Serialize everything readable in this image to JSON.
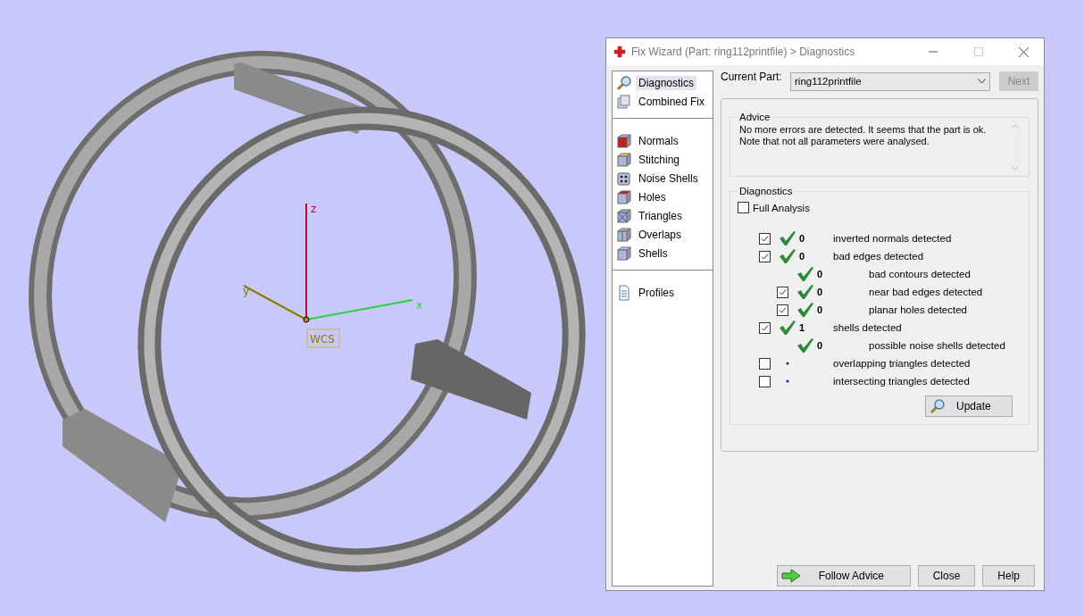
{
  "viewport": {
    "axes": [
      {
        "kind": "z",
        "label": "z"
      },
      {
        "kind": "y",
        "label": "y"
      },
      {
        "kind": "x",
        "label": "x"
      }
    ],
    "origin_label": "WCS"
  },
  "window": {
    "title": "Fix Wizard (Part: ring112printfile) > Diagnostics"
  },
  "sidebar": {
    "groups": [
      [
        {
          "label": "Diagnostics",
          "kind": "magnifier",
          "selected": true
        },
        {
          "label": "Combined Fix",
          "kind": "stack",
          "selected": false
        }
      ],
      [
        {
          "label": "Normals",
          "kind": "normals",
          "selected": false
        },
        {
          "label": "Stitching",
          "kind": "stitching",
          "selected": false
        },
        {
          "label": "Noise Shells",
          "kind": "dice",
          "selected": false
        },
        {
          "label": "Holes",
          "kind": "holes",
          "selected": false
        },
        {
          "label": "Triangles",
          "kind": "triangles",
          "selected": false
        },
        {
          "label": "Overlaps",
          "kind": "overlaps",
          "selected": false
        },
        {
          "label": "Shells",
          "kind": "cube",
          "selected": false
        }
      ],
      [
        {
          "label": "Profiles",
          "kind": "document",
          "selected": false
        }
      ]
    ]
  },
  "current_part": {
    "label": "Current Part:",
    "value": "ring112printfile"
  },
  "next_button": {
    "label": "Next",
    "disabled": true
  },
  "advice": {
    "title": "Advice",
    "lines": [
      "No more errors are detected. It seems that the part is ok.",
      "Note that not all parameters were analysed."
    ]
  },
  "diagnostics": {
    "title": "Diagnostics",
    "full_analysis": {
      "label": "Full Analysis",
      "checked": false
    },
    "rows": [
      {
        "label": "inverted normals detected",
        "checked": true,
        "kind": "ok",
        "count": "0"
      },
      {
        "label": "bad edges detected",
        "checked": true,
        "kind": "ok",
        "count": "0",
        "children": [
          {
            "label": "bad contours detected",
            "kind": "ok",
            "count": "0"
          },
          {
            "label": "near bad edges detected",
            "checked": true,
            "kind": "ok",
            "count": "0"
          },
          {
            "label": "planar holes detected",
            "checked": true,
            "kind": "ok",
            "count": "0"
          }
        ]
      },
      {
        "label": "shells detected",
        "checked": true,
        "kind": "ok",
        "count": "1",
        "children": [
          {
            "label": "possible noise shells detected",
            "kind": "ok",
            "count": "0"
          }
        ]
      },
      {
        "label": "overlapping triangles detected",
        "checked": false,
        "kind": "pending"
      },
      {
        "label": "intersecting triangles detected",
        "checked": false,
        "kind": "pending"
      }
    ],
    "update_button": "Update"
  },
  "buttons": [
    {
      "label": "Follow Advice",
      "kind": "follow"
    },
    {
      "label": "Close",
      "kind": "plain"
    },
    {
      "label": "Help",
      "kind": "plain"
    }
  ]
}
